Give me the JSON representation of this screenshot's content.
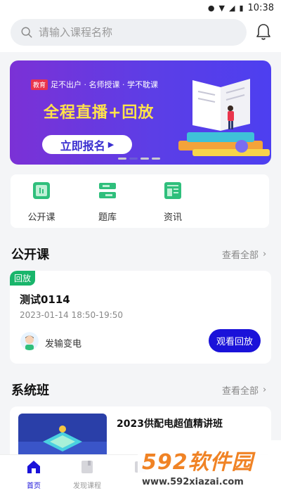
{
  "status": {
    "time": "10:38"
  },
  "search": {
    "placeholder": "请输入课程名称"
  },
  "banner": {
    "logo": "教育",
    "tagline": "足不出户 · 名师授课 · 学不耽课",
    "headline": "全程直播+回放",
    "cta": "立即报名",
    "colors": {
      "start": "#7b31d6",
      "end": "#4d3ff0",
      "headline": "#ffe24b"
    }
  },
  "quick": [
    {
      "label": "公开课",
      "icon": "live-screen-icon",
      "color": "#2fbf7c"
    },
    {
      "label": "题库",
      "icon": "question-bank-icon",
      "color": "#2fbf7c"
    },
    {
      "label": "资讯",
      "icon": "news-icon",
      "color": "#2fbf7c"
    }
  ],
  "open_section": {
    "title": "公开课",
    "more": "查看全部"
  },
  "open_card": {
    "badge": "回放",
    "title": "测试0114",
    "time": "2023-01-14   18:50-19:50",
    "teacher": "发输变电",
    "button": "观看回放"
  },
  "system_section": {
    "title": "系统班",
    "more": "查看全部"
  },
  "system_card": {
    "title": "2023供配电超值精讲班"
  },
  "tabs": [
    {
      "label": "首页",
      "icon": "home-icon"
    },
    {
      "label": "发现课程",
      "icon": "book-icon"
    },
    {
      "label": "",
      "icon": "study-icon"
    }
  ],
  "watermark": {
    "brand": "592软件园",
    "url": "www.592xiazai.com"
  },
  "accent": "#1a12d9"
}
